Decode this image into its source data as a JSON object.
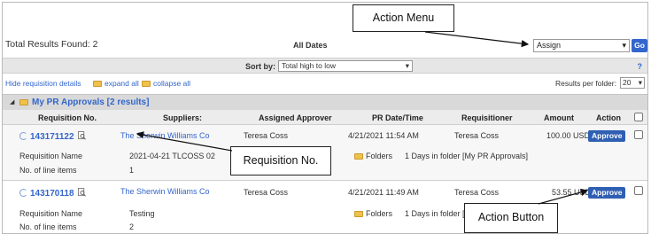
{
  "top": {
    "total_results": "Total Results Found: 2",
    "dates_label": "All Dates",
    "action_value": "Assign",
    "go_label": "Go"
  },
  "sortbar": {
    "sort_label": "Sort by:",
    "sort_value": "Total high to low",
    "help": "?"
  },
  "details": {
    "hide_label": "Hide requisition details",
    "expand_label": "expand all",
    "collapse_label": "collapse all",
    "results_per_folder_label": "Results per folder:",
    "results_per_folder_value": "20"
  },
  "folder": {
    "title": "My PR Approvals [2 results]"
  },
  "columns": [
    "Requisition No.",
    "Suppliers:",
    "Assigned Approver",
    "PR Date/Time",
    "Requisitioner",
    "Amount",
    "Action"
  ],
  "rows": [
    {
      "req_no": "143171122",
      "supplier": "The Sherwin Williams Co",
      "approver": "Teresa Coss",
      "date": "4/21/2021 11:54 AM",
      "requisitioner": "Teresa Coss",
      "amount": "100.00 USD",
      "action": "Approve",
      "name_label": "Requisition Name",
      "name_value": "2021-04-21 TLCOSS 02",
      "lines_label": "No. of line items",
      "lines_value": "1",
      "folders_label": "Folders",
      "folder_info": "1 Days in folder [My PR Approvals]"
    },
    {
      "req_no": "143170118",
      "supplier": "The Sherwin Williams Co",
      "approver": "Teresa Coss",
      "date": "4/21/2021 11:49 AM",
      "requisitioner": "Teresa Coss",
      "amount": "53.55 USD",
      "action": "Approve",
      "name_label": "Requisition Name",
      "name_value": "Testing",
      "lines_label": "No. of line items",
      "lines_value": "2",
      "folders_label": "Folders",
      "folder_info": "1 Days in folder [M"
    }
  ],
  "callouts": {
    "action_menu": "Action Menu",
    "requisition_no": "Requisition No.",
    "action_button": "Action Button"
  },
  "icons": {
    "folder": "folder-icon",
    "expand_triangle": "triangle-icon",
    "refresh": "refresh-icon",
    "magnifier": "magnifier-icon",
    "chevron": "chevron-down-icon"
  },
  "colors": {
    "link": "#3366cc",
    "button": "#2f5fb3",
    "folder": "#f0c14b"
  }
}
